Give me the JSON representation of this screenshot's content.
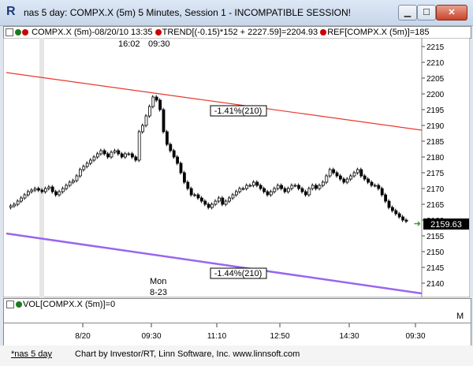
{
  "window": {
    "logo_letter": "R",
    "title": "nas 5 day: COMPX.X (5m) 5 Minutes, Session 1 - INCOMPATIBLE SESSION!",
    "min_glyph": "▁",
    "max_glyph": "☐",
    "close_glyph": "✕"
  },
  "legend": {
    "symbol": "COMPX.X (5m)-08/20/10 13:35",
    "trend": "TREND[(-0.15)*152 + 2227.59]=2204.93",
    "ref": "REF[COMPX.X (5m)]=185"
  },
  "chart": {
    "time_labels": [
      "16:02",
      "09:30"
    ],
    "day_label": [
      "Mon",
      "8-23"
    ],
    "trend_upper_label": "-1.41%(210)",
    "trend_lower_label": "-1.44%(210)",
    "last_price": "2159.63",
    "colors": {
      "trend_upper": "#e8392e",
      "trend_lower": "#9966ee",
      "candle": "#000000",
      "last_price_bg": "#000000"
    }
  },
  "volume": {
    "legend": "VOL[COMPX.X (5m)]=0",
    "m_label": "M"
  },
  "time_axis": {
    "labels": [
      "8/20",
      "09:30",
      "11:10",
      "12:50",
      "14:30",
      "09:30"
    ]
  },
  "footer": {
    "tab": "*nas 5 day",
    "credit": "Chart by Investor/RT, Linn Software, Inc. www.linnsoft.com"
  },
  "chart_data": {
    "type": "line",
    "title": "",
    "ylabel": "",
    "ylim": [
      2135,
      2217
    ],
    "y_ticks": [
      2140,
      2145,
      2150,
      2155,
      2160,
      2165,
      2170,
      2175,
      2180,
      2185,
      2190,
      2195,
      2200,
      2205,
      2210,
      2215
    ],
    "grid": false,
    "series": [
      {
        "values": [
          2164,
          2164.5,
          2165,
          2166,
          2167,
          2168,
          2169,
          2169.5,
          2170,
          2169.5,
          2169,
          2170,
          2170.5,
          2169,
          2168,
          2169,
          2170,
          2171,
          2172,
          2172.5,
          2174,
          2176,
          2177,
          2178,
          2179,
          2180,
          2181,
          2182,
          2181,
          2180,
          2181.5,
          2182,
          2181,
          2180,
          2181,
          2181,
          2180,
          2179,
          2188,
          2190,
          2193,
          2196,
          2199,
          2198,
          2195,
          2188,
          2184,
          2182,
          2180,
          2178,
          2175,
          2172,
          2170,
          2168,
          2168,
          2167,
          2166,
          2165,
          2164,
          2165,
          2166,
          2167,
          2165,
          2166,
          2167,
          2168,
          2169,
          2170,
          2170,
          2171,
          2171,
          2172,
          2171,
          2170,
          2169,
          2168,
          2169,
          2170,
          2171,
          2170,
          2169,
          2170,
          2171,
          2171,
          2170,
          2169,
          2168,
          2170,
          2171,
          2170,
          2171,
          2172,
          2174,
          2176,
          2175,
          2174,
          2173,
          2172,
          2173,
          2174,
          2175,
          2176,
          2174,
          2173,
          2172,
          2171,
          2171,
          2170,
          2168,
          2166,
          2164,
          2163,
          2162,
          2161,
          2160,
          2159.63
        ]
      }
    ]
  }
}
